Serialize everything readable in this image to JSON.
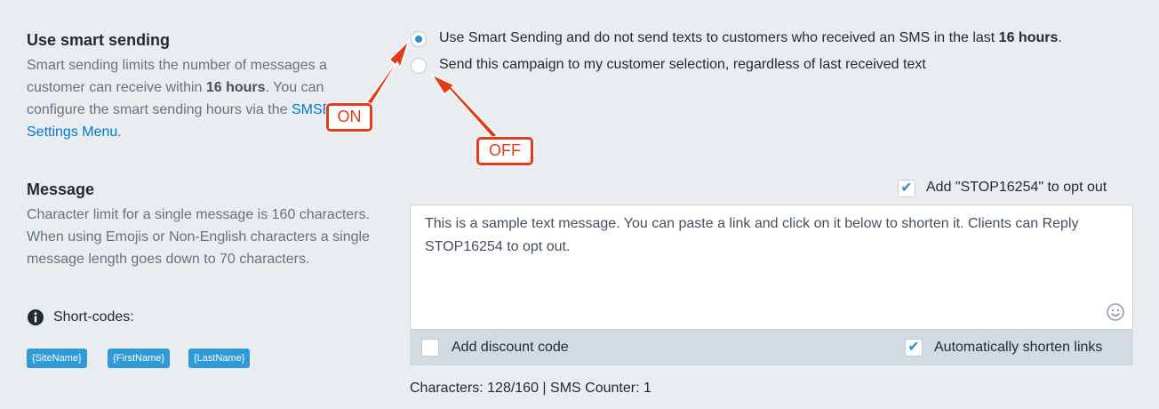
{
  "smart_sending": {
    "title": "Use smart sending",
    "desc_part1": "Smart sending limits the number of messages a customer can receive within ",
    "desc_bold": "16 hours",
    "desc_part2": ". You can configure the smart sending hours via the ",
    "desc_link": "SMSBump Settings Menu",
    "desc_end": ".",
    "option_on_text": "Use Smart Sending and do not send texts to customers who received an SMS in the last ",
    "option_on_bold": "16 hours",
    "option_on_end": ".",
    "option_off_text": "Send this campaign to my customer selection, regardless of last received text",
    "selected": "on"
  },
  "annotations": {
    "on_label": "ON",
    "off_label": "OFF",
    "color": "#e53a1a"
  },
  "message": {
    "title": "Message",
    "desc": "Character limit for a single message is 160 characters. When using Emojis or Non-English characters a single message length goes down to 70 characters.",
    "shortcodes_label": "Short-codes:",
    "shortcodes": [
      "{SiteName}",
      "{FirstName}",
      "{LastName}"
    ],
    "opt_out_label": "Add \"STOP16254\" to opt out",
    "opt_out_checked": true,
    "body_text": "This is a sample text message. You can paste a link and click on it below to shorten it. Clients can Reply STOP16254 to opt out.",
    "discount_label": "Add discount code",
    "discount_checked": false,
    "shorten_label": "Automatically shorten links",
    "shorten_checked": true,
    "counter_text": "Characters: 128/160 | SMS Counter: 1"
  },
  "icons": {
    "info": "info-circle-icon",
    "emoji": "emoji-smile-icon",
    "check": "checkmark-icon"
  },
  "colors": {
    "accent": "#2e8ece",
    "link": "#007ace",
    "tag": "#2e9ad6",
    "background": "#eaedf0"
  }
}
